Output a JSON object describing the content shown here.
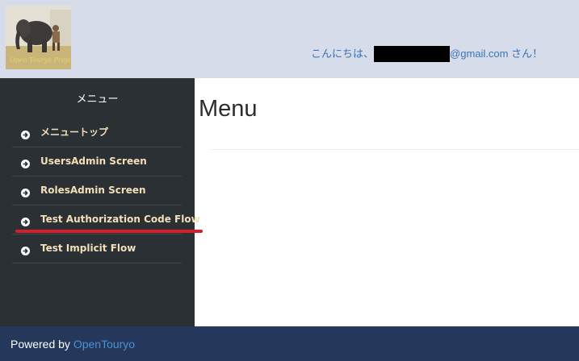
{
  "header": {
    "greeting_prefix": "こんにちは、",
    "greeting_suffix": "@gmail.com さん！",
    "logo_text": "Open Touryo Project"
  },
  "sidebar": {
    "title": "メニュー",
    "items": [
      {
        "label": "メニュートップ",
        "icon": "arrow-circle-right-icon"
      },
      {
        "label": "UsersAdmin Screen",
        "icon": "arrow-circle-right-icon"
      },
      {
        "label": "RolesAdmin Screen",
        "icon": "arrow-circle-right-icon"
      },
      {
        "label": "Test Authorization Code Flow",
        "icon": "arrow-circle-right-icon"
      },
      {
        "label": "Test Implicit Flow",
        "icon": "arrow-circle-right-icon"
      }
    ]
  },
  "main": {
    "title": "Menu"
  },
  "footer": {
    "powered_by": "Powered by",
    "link_text": "OpenTouryo"
  },
  "colors": {
    "header_bg": "#d6dce9",
    "sidebar_bg": "#2b3035",
    "sidebar_item_text": "#f3dfb8",
    "greeting_text": "#3a74b8",
    "footer_bg": "#25375a",
    "footer_link": "#4a8fd8",
    "annotation_underline": "#d91e2a"
  }
}
